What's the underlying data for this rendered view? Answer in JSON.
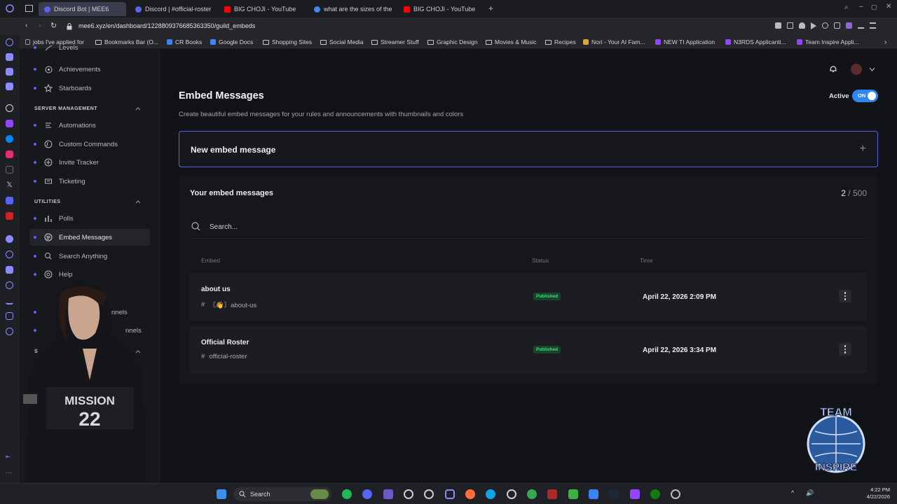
{
  "browser": {
    "tabs": [
      {
        "title": "Discord Bot | MEE6",
        "active": true,
        "color": "#5865f2"
      },
      {
        "title": "Discord | #official-roster",
        "active": false,
        "color": "#5865f2"
      },
      {
        "title": "BIG CHOJI - YouTube",
        "active": false,
        "color": "#ff0000"
      },
      {
        "title": "what are the sizes of the r",
        "active": false,
        "color": "#4285f4"
      },
      {
        "title": "BIG CHOJI - YouTube",
        "active": false,
        "color": "#ff0000"
      }
    ],
    "url": "mee6.xyz/en/dashboard/1228809376685363350/guild_embeds",
    "bookmarks": [
      "jobs I've applied for",
      "Bookmarks Bar (O...",
      "CR Books",
      "Google Docs",
      "Shopping Sites",
      "Social Media",
      "Streamer Stuff",
      "Graphic Design",
      "Movies & Music",
      "Recipes",
      "Nori - Your AI Fam...",
      "NEW TI Application",
      "N3RDS Applicanti...",
      "Team Inspire Appli..."
    ]
  },
  "sidebar": {
    "top_items": [
      {
        "label": "Levels",
        "icon": "levels-icon"
      },
      {
        "label": "Achievements",
        "icon": "achievements-icon"
      },
      {
        "label": "Starboards",
        "icon": "star-icon"
      }
    ],
    "server_management": {
      "heading": "SERVER MANAGEMENT",
      "items": [
        {
          "label": "Automations",
          "icon": "automations-icon"
        },
        {
          "label": "Custom Commands",
          "icon": "custom-commands-icon"
        },
        {
          "label": "Invite Tracker",
          "icon": "invite-tracker-icon"
        },
        {
          "label": "Ticketing",
          "icon": "ticket-icon"
        }
      ]
    },
    "utilities": {
      "heading": "UTILITIES",
      "items": [
        {
          "label": "Polls",
          "icon": "poll-icon"
        },
        {
          "label": "Embed Messages",
          "icon": "embed-icon",
          "active": true
        },
        {
          "label": "Search Anything",
          "icon": "search-icon"
        },
        {
          "label": "Help",
          "icon": "help-icon"
        }
      ]
    },
    "partial_items": [
      "nnels",
      "nnels"
    ],
    "partial_heading": "S"
  },
  "main": {
    "title": "Embed Messages",
    "description": "Create beautiful embed messages for your rules and announcements with thumbnails and colors",
    "active_label": "Active",
    "toggle_label": "ON",
    "new_embed_label": "New embed message",
    "list_title": "Your embed messages",
    "count_current": "2",
    "count_separator": " / ",
    "count_max": "500",
    "search_placeholder": "Search...",
    "columns": {
      "embed": "Embed",
      "status": "Status",
      "time": "Time"
    },
    "rows": [
      {
        "name": "about us",
        "channel": "〘👋〙about-us",
        "status": "Published",
        "time": "April 22, 2026 2:09 PM"
      },
      {
        "name": "Official Roster",
        "channel": "official-roster",
        "status": "Published",
        "time": "April 22, 2026 3:34 PM"
      }
    ]
  },
  "taskbar": {
    "search_label": "Search",
    "time": "4:22 PM",
    "date": "4/22/2026"
  },
  "colors": {
    "accent": "#5865f2",
    "toggle": "#2e86f6",
    "published_bg": "#16462a",
    "published_text": "#3ddc84"
  }
}
